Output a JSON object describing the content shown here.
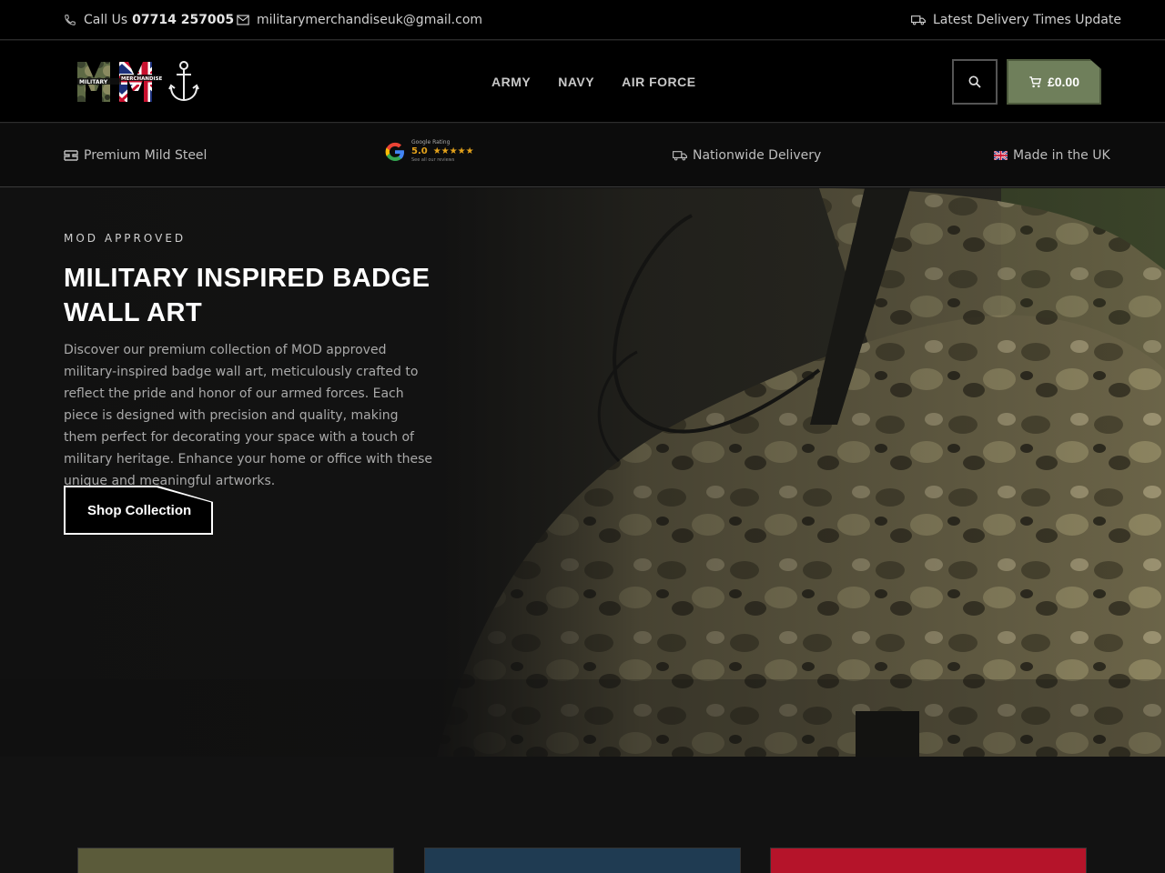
{
  "topbar": {
    "call_label": "Call Us",
    "phone": "07714 257005",
    "email": "militarymerchandiseuk@gmail.com",
    "delivery_link": "Latest Delivery Times Update"
  },
  "header": {
    "logo_text": "MILITARY MERCHANDISE",
    "nav": [
      "ARMY",
      "NAVY",
      "AIR FORCE"
    ],
    "cart_total": "£0.00"
  },
  "usp": {
    "steel": "Premium Mild Steel",
    "google_label": "Google Rating",
    "google_score": "5.0",
    "google_stars": "★★★★★",
    "google_sub": "See all our reviews",
    "delivery": "Nationwide Delivery",
    "made": "Made in the UK"
  },
  "hero": {
    "eyebrow": "MOD APPROVED",
    "title": "MILITARY INSPIRED BADGE WALL ART",
    "description": "Discover our premium collection of MOD approved military-inspired badge wall art, meticulously crafted to reflect the pride and honor of our armed forces. Each piece is designed with precision and quality, making them perfect for decorating your space with a touch of military heritage. Enhance your home or office with these unique and meaningful artworks.",
    "cta": "Shop Collection"
  },
  "colors": {
    "accent": "#6f7f5b",
    "army_card": "#5b5b3a",
    "navy_card": "#1f3b52",
    "raf_card": "#b5142a"
  }
}
